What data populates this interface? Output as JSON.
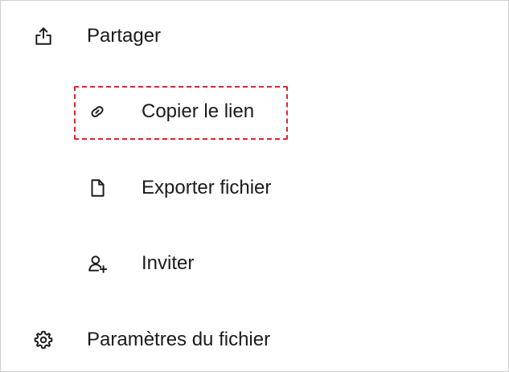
{
  "menu": {
    "share": {
      "label": "Partager",
      "icon": "share-upload-icon"
    },
    "share_submenu": [
      {
        "label": "Copier le lien",
        "icon": "link-icon",
        "highlighted": true
      },
      {
        "label": "Exporter fichier",
        "icon": "file-icon"
      },
      {
        "label": "Inviter",
        "icon": "add-person-icon"
      }
    ],
    "settings": {
      "label": "Paramètres du fichier",
      "icon": "gear-icon"
    }
  },
  "highlight": {
    "color": "#e0242e",
    "style": "dashed"
  }
}
